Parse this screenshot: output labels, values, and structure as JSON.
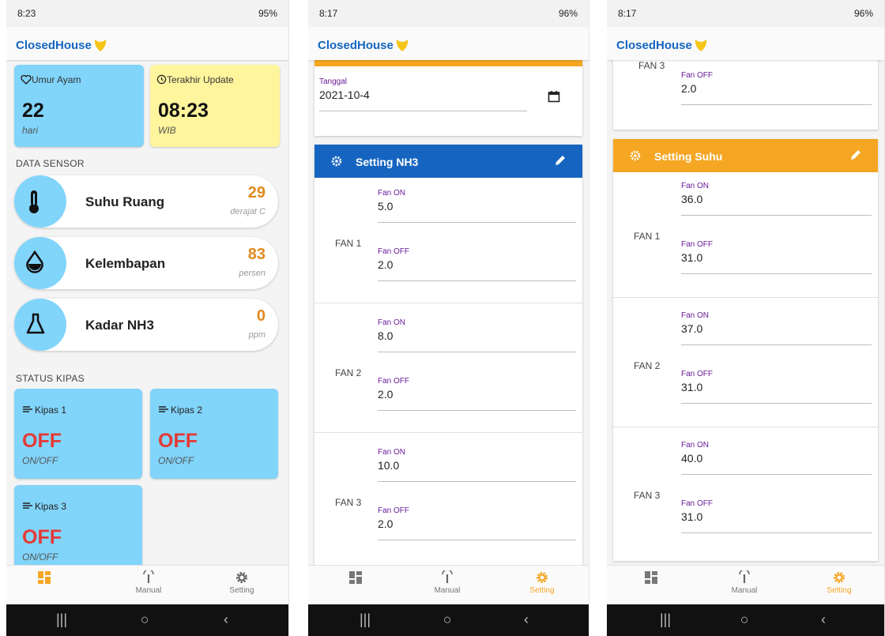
{
  "colors": {
    "brand": "#1565c0",
    "accent_orange": "#f5a623",
    "setting_blue": "#1565c0",
    "tile_blue": "#81d4fa",
    "tile_yellow": "#fff59d",
    "off_red": "#e53935"
  },
  "screens": [
    {
      "status": {
        "time": "8:23",
        "right": "95%"
      },
      "app_title": "ClosedHouse",
      "cards": {
        "umur": {
          "icon": "heart-icon",
          "title": "Umur Ayam",
          "value": "22",
          "unit": "hari"
        },
        "update": {
          "icon": "history-icon",
          "title": "Terakhir Update",
          "value": "08:23",
          "unit": "WIB"
        }
      },
      "data_sensor_label": "DATA SENSOR",
      "sensors": [
        {
          "icon": "thermometer-icon",
          "name": "Suhu Ruang",
          "value": "29",
          "unit": "derajat C"
        },
        {
          "icon": "water-drop-icon",
          "name": "Kelembapan",
          "value": "83",
          "unit": "persen"
        },
        {
          "icon": "flask-icon",
          "name": "Kadar NH3",
          "value": "0",
          "unit": "ppm"
        }
      ],
      "status_kipas_label": "STATUS KIPAS",
      "fans": [
        {
          "icon": "wind-icon",
          "name": "Kipas 1",
          "state": "OFF",
          "sub": "ON/OFF"
        },
        {
          "icon": "wind-icon",
          "name": "Kipas 2",
          "state": "OFF",
          "sub": "ON/OFF"
        },
        {
          "icon": "wind-icon",
          "name": "Kipas 3",
          "state": "OFF",
          "sub": "ON/OFF"
        }
      ],
      "nav": {
        "manual": "Manual",
        "setting": "Setting"
      }
    },
    {
      "status": {
        "time": "8:17",
        "right": "96%"
      },
      "app_title": "ClosedHouse",
      "date_field": {
        "label": "Tanggal",
        "value": "2021-10-4"
      },
      "setting_title": "Setting NH3",
      "fans": [
        {
          "label": "FAN 1",
          "on_label": "Fan ON",
          "on_value": "5.0",
          "off_label": "Fan OFF",
          "off_value": "2.0"
        },
        {
          "label": "FAN 2",
          "on_label": "Fan ON",
          "on_value": "8.0",
          "off_label": "Fan OFF",
          "off_value": "2.0"
        },
        {
          "label": "FAN 3",
          "on_label": "Fan ON",
          "on_value": "10.0",
          "off_label": "Fan OFF",
          "off_value": "2.0"
        }
      ],
      "nav": {
        "manual": "Manual",
        "setting": "Setting"
      }
    },
    {
      "status": {
        "time": "8:17",
        "right": "96%"
      },
      "app_title": "ClosedHouse",
      "prev": {
        "label": "FAN 3",
        "off_label": "Fan OFF",
        "off_value": "2.0"
      },
      "setting_title": "Setting Suhu",
      "fans": [
        {
          "label": "FAN 1",
          "on_label": "Fan ON",
          "on_value": "36.0",
          "off_label": "Fan OFF",
          "off_value": "31.0"
        },
        {
          "label": "FAN 2",
          "on_label": "Fan ON",
          "on_value": "37.0",
          "off_label": "Fan OFF",
          "off_value": "31.0"
        },
        {
          "label": "FAN 3",
          "on_label": "Fan ON",
          "on_value": "40.0",
          "off_label": "Fan OFF",
          "off_value": "31.0"
        }
      ],
      "nav": {
        "manual": "Manual",
        "setting": "Setting"
      }
    }
  ]
}
